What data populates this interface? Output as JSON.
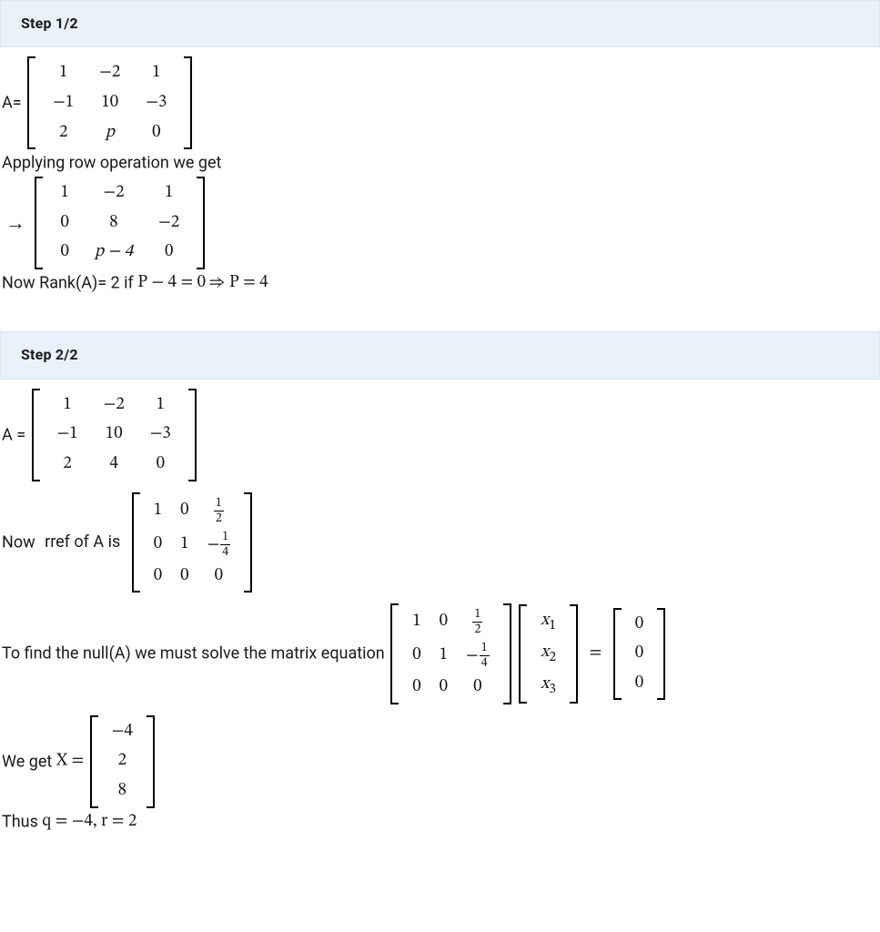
{
  "step1": {
    "header": "Step 1/2",
    "lead": "A=",
    "A": [
      [
        "1",
        "−2",
        "1"
      ],
      [
        "−1",
        "10",
        "−3"
      ],
      [
        "2",
        "p",
        "0"
      ]
    ],
    "apply_text": "Applying row operation we get",
    "arrow": "→",
    "A_reduced": [
      [
        "1",
        "−2",
        "1"
      ],
      [
        "0",
        "8",
        "−2"
      ],
      [
        "0",
        "p − 4",
        "0"
      ]
    ],
    "rank_prefix": "Now Rank(A)= 2 if ",
    "rank_math": "P − 4 = 0 ⇒ P = 4"
  },
  "step2": {
    "header": "Step 2/2",
    "lead": "A  =",
    "A": [
      [
        "1",
        "−2",
        "1"
      ],
      [
        "−1",
        "10",
        "−3"
      ],
      [
        "2",
        "4",
        "0"
      ]
    ],
    "rref_prefix": "Now",
    "rref_mid": "rref  of A is",
    "rref": [
      [
        "1",
        "0",
        {
          "frac": [
            "1",
            "2"
          ]
        }
      ],
      [
        "0",
        "1",
        {
          "negfrac": [
            "1",
            "4"
          ]
        }
      ],
      [
        "0",
        "0",
        "0"
      ]
    ],
    "null_text": "To find the null(A) we must solve the matrix equation",
    "xvec": [
      [
        "x_1"
      ],
      [
        "x_2"
      ],
      [
        "x_3"
      ]
    ],
    "eq_sign": "=",
    "zero": [
      [
        "0"
      ],
      [
        "0"
      ],
      [
        "0"
      ]
    ],
    "we_get_prefix": "We get ",
    "we_get_math": "X =",
    "X": [
      [
        "−4"
      ],
      [
        "2"
      ],
      [
        "8"
      ]
    ],
    "thus_prefix": "Thus ",
    "thus_math": "q = −4, r = 2"
  }
}
